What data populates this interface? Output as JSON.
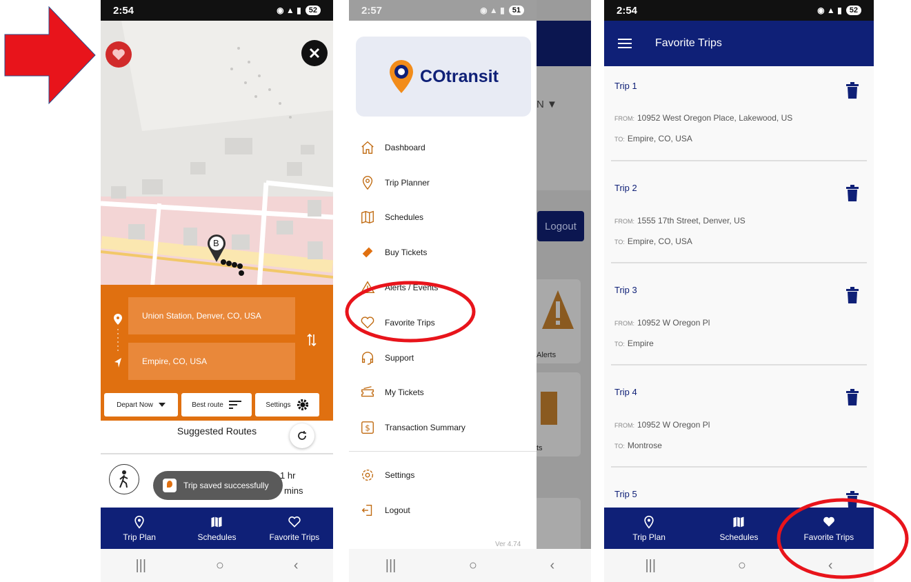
{
  "screen1": {
    "status": {
      "time": "2:54",
      "battery": "52"
    },
    "route": {
      "from": "Union Station, Denver, CO, USA",
      "to": "Empire, CO, USA",
      "depart": "Depart Now",
      "sort": "Best route",
      "settings": "Settings"
    },
    "map_labels": {
      "marker": "B"
    },
    "suggested_title": "Suggested Routes",
    "duration_top": "1 hr",
    "duration_bottom": "mins",
    "toast": "Trip saved successfully",
    "tabs": [
      "Trip Plan",
      "Schedules",
      "Favorite Trips"
    ]
  },
  "screen2": {
    "status": {
      "time": "2:57",
      "battery": "51"
    },
    "brand": "COtransit",
    "behind": {
      "lang": "N",
      "logout": "Logout",
      "alerts": "Alerts",
      "ts": "ts"
    },
    "menu": [
      "Dashboard",
      "Trip Planner",
      "Schedules",
      "Buy Tickets",
      "Alerts / Events",
      "Favorite Trips",
      "Support",
      "My Tickets",
      "Transaction Summary",
      "Settings",
      "Logout"
    ],
    "version": "Ver 4.74"
  },
  "screen3": {
    "status": {
      "time": "2:54",
      "battery": "52"
    },
    "title": "Favorite Trips",
    "from_key": "FROM:",
    "to_key": "TO:",
    "trips": [
      {
        "title": "Trip 1",
        "from": "10952 West Oregon Place, Lakewood, US",
        "to": "Empire, CO, USA"
      },
      {
        "title": "Trip 2",
        "from": "1555 17th Street, Denver, US",
        "to": "Empire, CO, USA"
      },
      {
        "title": "Trip 3",
        "from": "10952 W Oregon Pl",
        "to": "Empire"
      },
      {
        "title": "Trip 4",
        "from": "10952 W Oregon Pl",
        "to": "Montrose"
      },
      {
        "title": "Trip 5"
      }
    ],
    "tabs": [
      "Trip Plan",
      "Schedules",
      "Favorite Trips"
    ]
  },
  "colors": {
    "navy": "#0f2077",
    "orange": "#e07010",
    "annotation_red": "#e8141b"
  }
}
